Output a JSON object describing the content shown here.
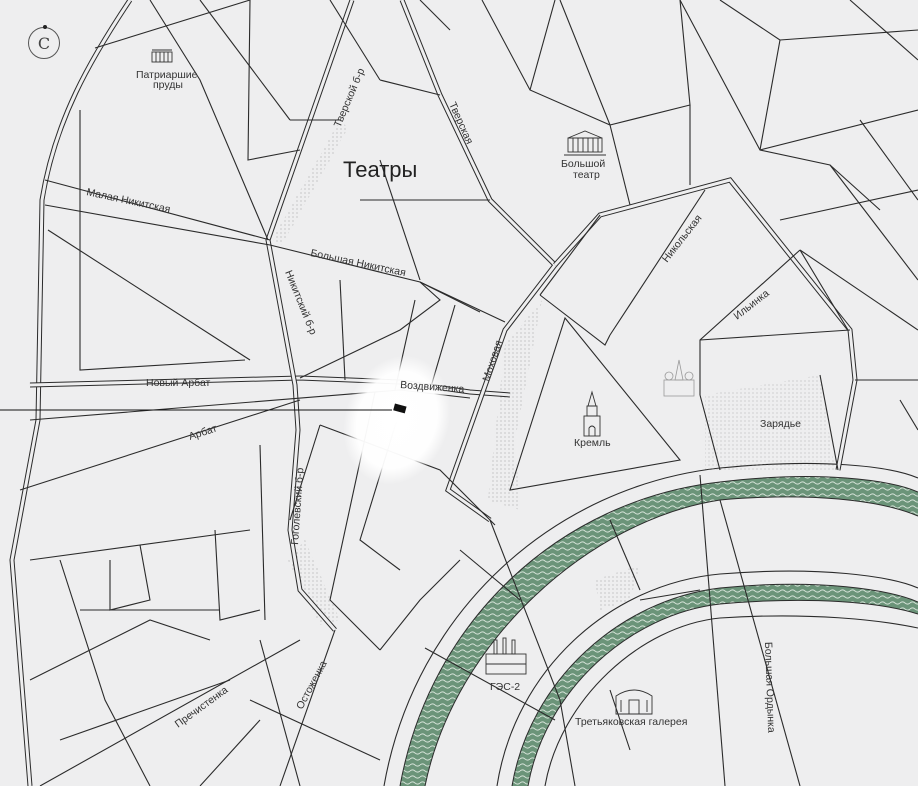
{
  "map": {
    "title": "Театры",
    "compass_label": "С",
    "streets": {
      "tverskoy": "Тверской б-р",
      "tverskaya": "Тверская",
      "malaya_nikitskaya": "Малая Никитская",
      "bolshaya_nikitskaya": "Большая Никитская",
      "nikitsky": "Никитский б-р",
      "novy_arbat": "Новый Арбат",
      "vozdvizhenka": "Воздвиженка",
      "mokhovaya": "Моховая",
      "arbat": "Арбат",
      "gogolevsky": "Гоголевский б-р",
      "nikolskaya": "Никольская",
      "ilyinka": "Ильинка",
      "prechistenka": "Пречистенка",
      "ostozhenka": "Остоженка",
      "bolshaya_ordynka": "Большая Ордынка"
    },
    "places": {
      "patriarshie_line1": "Патриаршие",
      "patriarshie_line2": "пруды",
      "bolshoi_line1": "Большой",
      "bolshoi_line2": "театр",
      "kremlin": "Кремль",
      "zaryadye": "Зарядье",
      "ges2": "ГЭС-2",
      "tretyakov": "Третьяковская галерея"
    },
    "colors": {
      "background": "#eeeeef",
      "river": "#5f8a70",
      "road": "#2b2b2b",
      "highlight": "#ffffff"
    }
  }
}
